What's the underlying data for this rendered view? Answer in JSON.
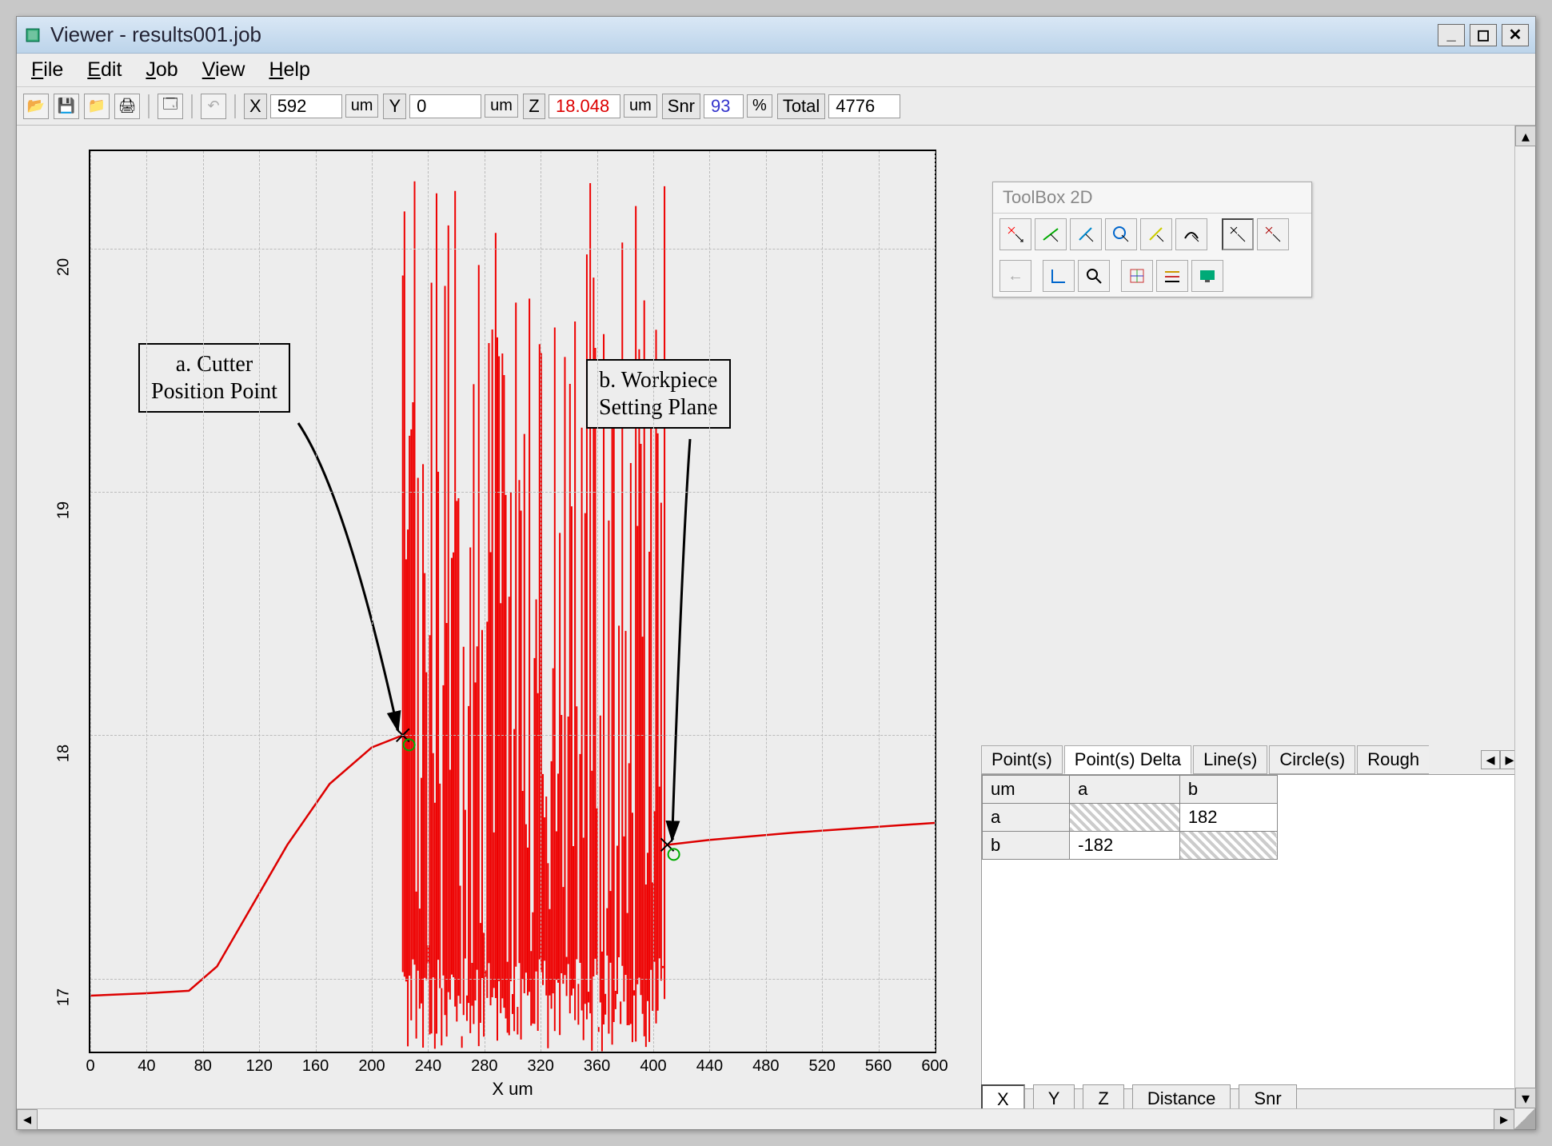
{
  "window": {
    "title": "Viewer - results001.job"
  },
  "menu": {
    "items": [
      "File",
      "Edit",
      "Job",
      "View",
      "Help"
    ]
  },
  "toolbar": {
    "x_label": "X",
    "x_value": "592",
    "y_label": "Y",
    "y_value": "0",
    "z_label": "Z",
    "z_value": "18.048",
    "unit": "um",
    "snr_label": "Snr",
    "snr_value": "93",
    "snr_unit": "%",
    "total_label": "Total",
    "total_value": "4776"
  },
  "chart_data": {
    "type": "line",
    "xlabel": "X um",
    "ylabel": "",
    "x_ticks": [
      0,
      40,
      80,
      120,
      160,
      200,
      240,
      280,
      320,
      360,
      400,
      440,
      480,
      520,
      560,
      600
    ],
    "y_ticks": [
      17,
      18,
      19,
      20
    ],
    "xlim": [
      0,
      600
    ],
    "ylim": [
      16.7,
      20.4
    ],
    "baseline": [
      {
        "x": 0,
        "y": 16.93
      },
      {
        "x": 40,
        "y": 16.94
      },
      {
        "x": 70,
        "y": 16.95
      },
      {
        "x": 90,
        "y": 17.05
      },
      {
        "x": 110,
        "y": 17.25
      },
      {
        "x": 140,
        "y": 17.55
      },
      {
        "x": 170,
        "y": 17.8
      },
      {
        "x": 200,
        "y": 17.95
      },
      {
        "x": 222,
        "y": 18.0
      },
      {
        "x": 410,
        "y": 17.55
      },
      {
        "x": 440,
        "y": 17.57
      },
      {
        "x": 500,
        "y": 17.6
      },
      {
        "x": 600,
        "y": 17.64
      }
    ],
    "rough_region_xrange": [
      222,
      408
    ],
    "rough_region_yrange": [
      16.7,
      20.3
    ],
    "markers": [
      {
        "name": "a",
        "x": 222,
        "y": 18.0
      },
      {
        "name": "b",
        "x": 410,
        "y": 17.55
      }
    ],
    "annotations": [
      {
        "id": "a",
        "lines": [
          "a. Cutter",
          "Position Point"
        ]
      },
      {
        "id": "b",
        "lines": [
          "b. Workpiece",
          "Setting Plane"
        ]
      }
    ]
  },
  "toolbox": {
    "title": "ToolBox 2D"
  },
  "tabs": {
    "items": [
      "Point(s)",
      "Point(s) Delta",
      "Line(s)",
      "Circle(s)",
      "Rough"
    ],
    "active": 1
  },
  "delta_table": {
    "unit_header": "um",
    "cols": [
      "a",
      "b"
    ],
    "rows": [
      {
        "label": "a",
        "a": "",
        "b": "182"
      },
      {
        "label": "b",
        "a": "-182",
        "b": ""
      }
    ]
  },
  "axis_buttons": {
    "items": [
      "X",
      "Y",
      "Z",
      "Distance",
      "Snr"
    ],
    "active": 0
  }
}
